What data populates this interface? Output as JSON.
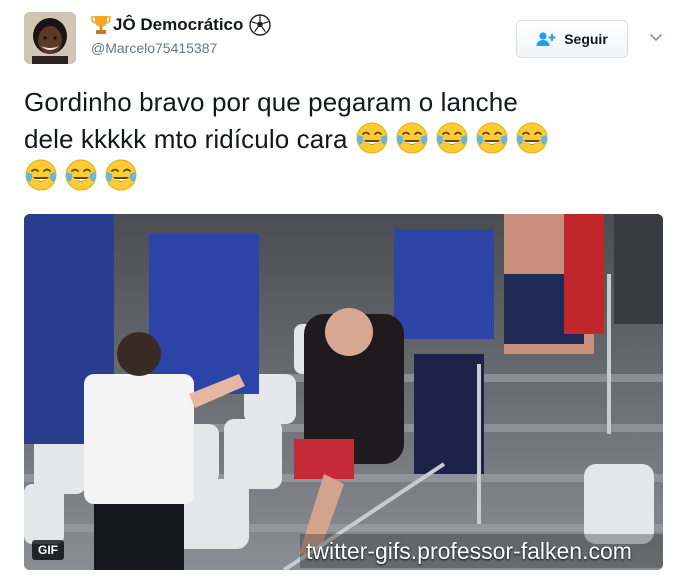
{
  "user": {
    "display_name": "JÔ Democrático",
    "handle": "@Marcelo75415387",
    "avatar_icon": "profile-photo",
    "name_prefix_icon": "trophy-icon",
    "name_suffix_icon": "soccer-ball-icon"
  },
  "follow": {
    "label": "Seguir",
    "icon": "add-user-icon"
  },
  "tweet": {
    "text_line1": "Gordinho bravo por que pegaram o lanche",
    "text_line2": "dele kkkkk mto ridículo cara",
    "emoji": "face-with-tears-of-joy",
    "emoji_count": 8
  },
  "media": {
    "badge": "GIF",
    "watermark": "twitter-gifs.professor-falken.com"
  },
  "colors": {
    "text": "#14171a",
    "muted": "#657786",
    "accent": "#1da1f2"
  }
}
